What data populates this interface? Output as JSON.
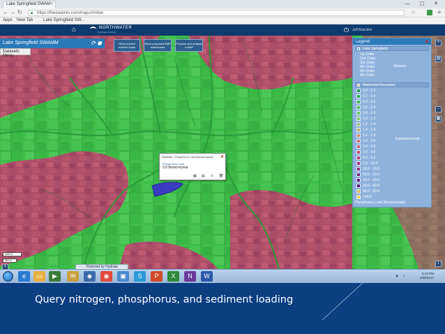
{
  "browser": {
    "tab_title": "Lake Springfield SWAM",
    "url": "https://theswamm.com/maps/#/view",
    "bookmarks": [
      "Apps",
      "New Tab",
      "Lake Springfield SW..."
    ]
  },
  "app": {
    "logo_text": "NORTHWATER",
    "logo_subtext": "Northwater Partners",
    "user_name": "Jeff Boeckler",
    "title": "Lake Springfield SWAMM",
    "datasets_menu": "Datasets Menu",
    "tool_buttons": [
      {
        "label": "Show current nutrient loads"
      },
      {
        "label": "Show proposed BMP watersheds"
      },
      {
        "label": "Propose and analyze a BMP"
      }
    ]
  },
  "legend": {
    "title": "Legend",
    "layer_name": "Lake Springfield",
    "streams": [
      "1st Order",
      "2nd Order",
      "3rd Order",
      "4th Order",
      "5th Order",
      "6th Order"
    ],
    "streams_label": "Streams",
    "watershed_boundary": "Watershed Boundary",
    "subwatershed_label": "Subwatersheds",
    "classes": [
      {
        "label": "0.0 - 0.2",
        "color": "#1f9a4a"
      },
      {
        "label": "0.2 - 0.4",
        "color": "#2daa52"
      },
      {
        "label": "0.4 - 0.6",
        "color": "#3eb55a"
      },
      {
        "label": "0.6 - 0.8",
        "color": "#55bd5e"
      },
      {
        "label": "0.8 - 1.0",
        "color": "#6cc463"
      },
      {
        "label": "1.0 - 1.2",
        "color": "#86c96a"
      },
      {
        "label": "1.2 - 1.4",
        "color": "#a0c46c"
      },
      {
        "label": "1.4 - 1.6",
        "color": "#b8ad6c"
      },
      {
        "label": "1.6 - 1.8",
        "color": "#c59270"
      },
      {
        "label": "1.8 - 2.0",
        "color": "#c97774"
      },
      {
        "label": "2.0 - 3.0",
        "color": "#c95e76"
      },
      {
        "label": "3.0 - 4.0",
        "color": "#c64a78"
      },
      {
        "label": "4.0 - 5.0",
        "color": "#bb3a7a"
      },
      {
        "label": "5.0 - 10.0",
        "color": "#a8307c"
      },
      {
        "label": "10.0 - 15.0",
        "color": "#93297f"
      },
      {
        "label": "15.0 - 20.0",
        "color": "#7d2382"
      },
      {
        "label": "20.0 - 30.0",
        "color": "#6a1f86"
      },
      {
        "label": "30.0 - 40.0",
        "color": "#561b88"
      },
      {
        "label": "40.0 - 50.0",
        "color": "#d6c24e"
      },
      {
        "label": ">50.0",
        "color": "#e8d94c"
      }
    ],
    "units": "Phosphorus Load (lbs/acre/year)"
  },
  "popup": {
    "title": "SWAMM - Phosphorus Load (lbs/acre/year)",
    "field_label": "Phosphorus Load",
    "value": "3.0 lbs/acre/year"
  },
  "map": {
    "scale_1": "2000 ft",
    "scale_2": "500 m",
    "powered_by": "Powered by Hydrata"
  },
  "taskbar": {
    "time": "5:43 PM",
    "date": "2/28/2017"
  },
  "caption": "Query nitrogen, phosphorus, and sediment loading"
}
